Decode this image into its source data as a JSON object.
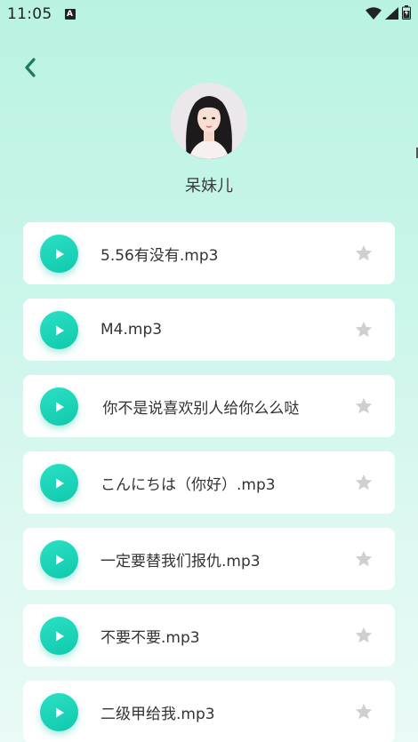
{
  "status_bar": {
    "time": "11:05",
    "notification_icon": "A"
  },
  "profile": {
    "name": "呆妹儿"
  },
  "tracks": [
    {
      "title": "5.56有没有.mp3"
    },
    {
      "title": "M4.mp3"
    },
    {
      "title": "吗 你不是说喜欢别人给你么么哒"
    },
    {
      "title": "こんにちは（你好）.mp3"
    },
    {
      "title": "一定要替我们报仇.mp3"
    },
    {
      "title": "不要不要.mp3"
    },
    {
      "title": "二级甲给我.mp3"
    }
  ],
  "colors": {
    "accent": "#14cdb0",
    "back_arrow": "#1f7a5a",
    "star": "#cfcfcf"
  },
  "icons": {
    "back": "chevron-left-icon",
    "play": "play-icon",
    "favorite": "star-icon",
    "wifi": "wifi-icon",
    "signal": "signal-icon",
    "battery": "battery-icon"
  }
}
